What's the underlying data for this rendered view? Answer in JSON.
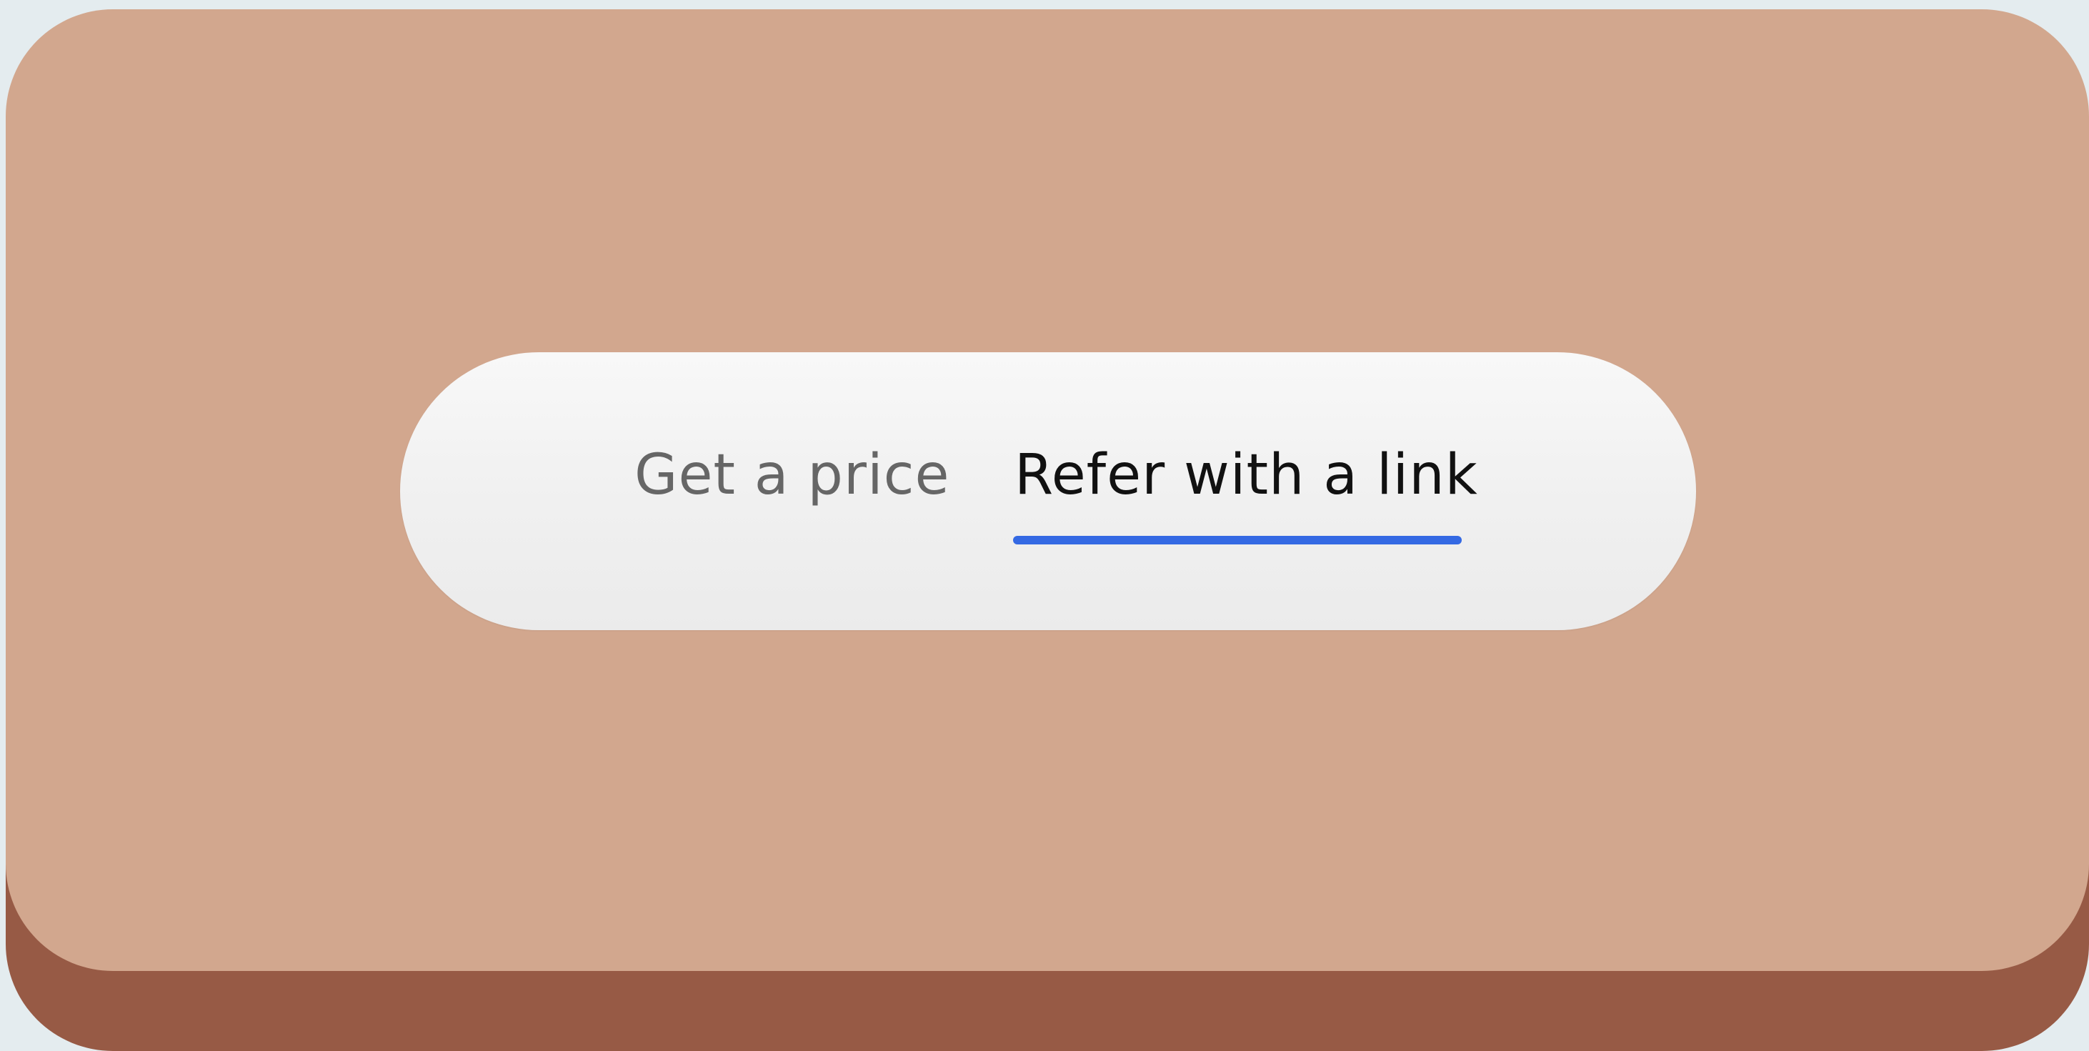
{
  "tabs": [
    {
      "label": "Get a price",
      "active": false
    },
    {
      "label": "Refer with a link",
      "active": true
    }
  ],
  "colors": {
    "page_background": "#e4ecef",
    "card": "#d2a78e",
    "card_shadow": "#975a45",
    "tab_bar": "#f2f2f2",
    "inactive_tab_text": "#666666",
    "active_tab_text": "#111111",
    "active_indicator": "#3469e3"
  }
}
